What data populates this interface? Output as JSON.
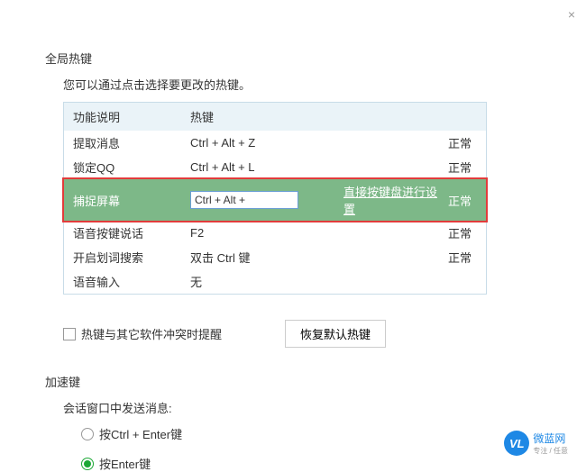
{
  "close_icon": "×",
  "section1": {
    "title": "全局热键",
    "desc": "您可以通过点击选择要更改的热键。",
    "headers": {
      "col1": "功能说明",
      "col2": "热键"
    },
    "rows": [
      {
        "name": "提取消息",
        "hotkey": "Ctrl + Alt + Z",
        "hint": "",
        "status": "正常"
      },
      {
        "name": "锁定QQ",
        "hotkey": "Ctrl + Alt + L",
        "hint": "",
        "status": "正常"
      },
      {
        "name": "捕捉屏幕",
        "hotkey": "Ctrl + Alt + ",
        "hint": "直接按键盘进行设置",
        "status": "正常"
      },
      {
        "name": "语音按键说话",
        "hotkey": "F2",
        "hint": "",
        "status": "正常"
      },
      {
        "name": "开启划词搜索",
        "hotkey": "双击 Ctrl 键",
        "hint": "",
        "status": "正常"
      },
      {
        "name": "语音输入",
        "hotkey": "无",
        "hint": "",
        "status": ""
      }
    ],
    "conflict_checkbox": "热键与其它软件冲突时提醒",
    "restore_btn": "恢复默认热键"
  },
  "section2": {
    "title": "加速键",
    "desc": "会话窗口中发送消息:",
    "radios": [
      {
        "label": "按Ctrl + Enter键",
        "checked": false
      },
      {
        "label": "按Enter键",
        "checked": true
      }
    ]
  },
  "logo": {
    "initials": "VL",
    "name": "微蓝网",
    "sub": "专注 / 任意"
  }
}
